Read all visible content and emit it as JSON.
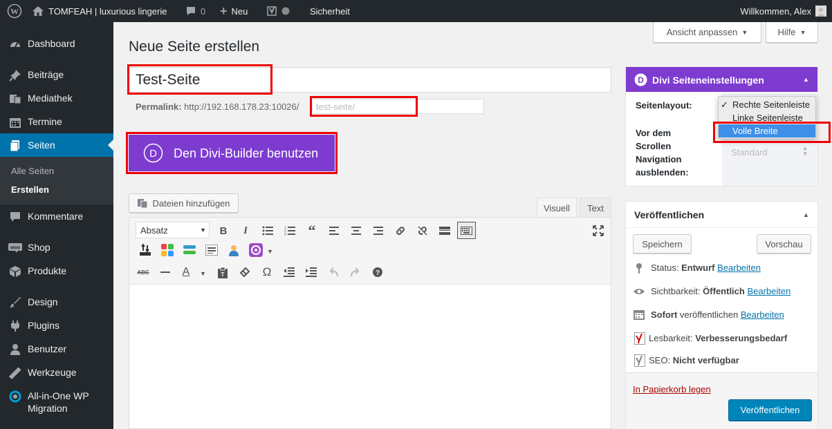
{
  "adminbar": {
    "site_name": "TOMFEAH | luxurious lingerie",
    "comments_count": "0",
    "new_label": "Neu",
    "security_label": "Sicherheit",
    "greeting": "Willkommen, Alex"
  },
  "sidebar": {
    "items": [
      {
        "label": "Dashboard",
        "icon": "dashboard-icon"
      },
      {
        "label": "Beiträge",
        "icon": "pin-icon"
      },
      {
        "label": "Mediathek",
        "icon": "media-icon"
      },
      {
        "label": "Termine",
        "icon": "calendar-icon"
      },
      {
        "label": "Seiten",
        "icon": "pages-icon"
      },
      {
        "label": "Kommentare",
        "icon": "comment-icon"
      },
      {
        "label": "Shop",
        "icon": "woo-icon"
      },
      {
        "label": "Produkte",
        "icon": "products-icon"
      },
      {
        "label": "Design",
        "icon": "brush-icon"
      },
      {
        "label": "Plugins",
        "icon": "plugin-icon"
      },
      {
        "label": "Benutzer",
        "icon": "user-icon"
      },
      {
        "label": "Werkzeuge",
        "icon": "wrench-icon"
      },
      {
        "label": "All-in-One WP",
        "label2": "Migration",
        "icon": "migration-icon"
      }
    ],
    "submenu": [
      "Alle Seiten",
      "Erstellen"
    ]
  },
  "screen_options": {
    "label": "Ansicht anpassen",
    "help": "Hilfe"
  },
  "page_title": "Neue Seite erstellen",
  "title_input": "Test-Seite",
  "permalink": {
    "label": "Permalink:",
    "base": "http://192.168.178.23:10026/",
    "slug": "test-seite/"
  },
  "divi_button": "Den Divi-Builder benutzen",
  "editor": {
    "add_media": "Dateien hinzufügen",
    "tab_visual": "Visuell",
    "tab_text": "Text",
    "format_select": "Absatz"
  },
  "divi_box": {
    "title": "Divi Seiteneinstellungen",
    "layout_label": "Seitenlayout:",
    "layout_options": [
      "Rechte Seitenleiste",
      "Linke Seitenleiste",
      "Volle Breite"
    ],
    "nav_label_lines": [
      "Vor dem",
      "Scrollen",
      "Navigation",
      "ausblenden:"
    ],
    "nav_select": "Standard"
  },
  "publish_box": {
    "title": "Veröffentlichen",
    "save": "Speichern",
    "preview": "Vorschau",
    "status_label": "Status:",
    "status_value": "Entwurf",
    "visibility_label": "Sichtbarkeit:",
    "visibility_value": "Öffentlich",
    "schedule_value": "Sofort",
    "schedule_label": "veröffentlichen",
    "edit_link": "Bearbeiten",
    "readability_label": "Lesbarkeit:",
    "readability_value": "Verbesserungsbedarf",
    "seo_label": "SEO:",
    "seo_value": "Nicht verfügbar",
    "trash": "In Papierkorb legen",
    "publish": "Veröffentlichen"
  },
  "colors": {
    "divi_purple": "#7e3bd0",
    "wp_blue": "#0073aa",
    "highlight_red": "#ee0000",
    "admin_dark": "#23282d"
  }
}
